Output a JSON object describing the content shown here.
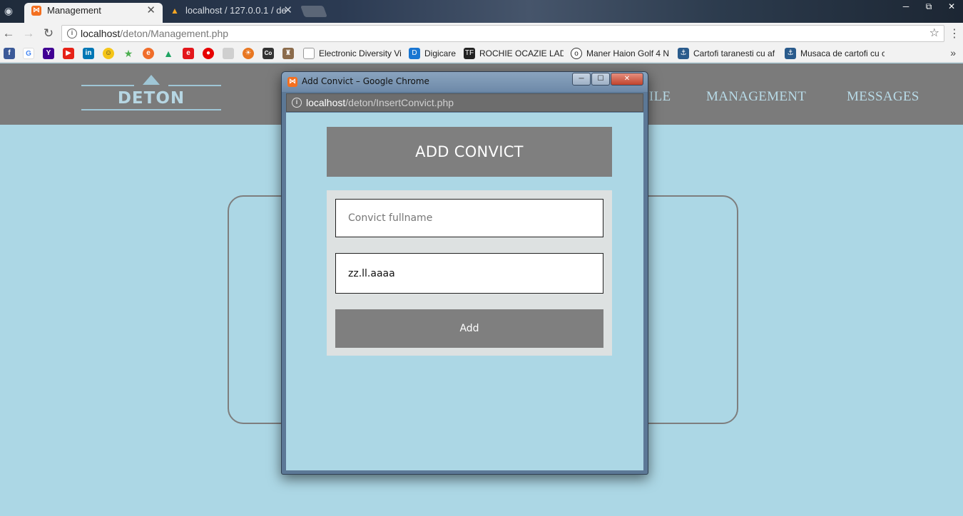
{
  "browser": {
    "tabs": [
      {
        "title": "Management",
        "active": true
      },
      {
        "title": "localhost / 127.0.0.1 / de",
        "active": false
      }
    ],
    "address": {
      "host": "localhost",
      "path": "/deton/Management.php"
    },
    "bookmarks": [
      {
        "label": "Electronic Diversity Vi"
      },
      {
        "label": "Digicare"
      },
      {
        "label": "ROCHIE OCAZIE LADY"
      },
      {
        "label": "Maner Haion Golf 4 N"
      },
      {
        "label": "Cartofi taranesti cu af"
      },
      {
        "label": "Musaca de cartofi cu c"
      }
    ],
    "bookmark_icons": [
      "facebook-icon",
      "google-icon",
      "yahoo-icon",
      "youtube-icon",
      "linkedin-icon",
      "smiley-icon",
      "star-person-icon",
      "orange-circle-icon",
      "google-drive-icon",
      "emag-icon",
      "vodafone-icon",
      "document-icon",
      "sun-icon",
      "co-icon",
      "castle-icon"
    ]
  },
  "site": {
    "logo": "DETON",
    "nav": [
      "ILE",
      "MANAGEMENT",
      "MESSAGES"
    ]
  },
  "popup": {
    "title": "Add Convict – Google Chrome",
    "address": {
      "host": "localhost",
      "path": "/deton/InsertConvict.php"
    },
    "form": {
      "header": "ADD CONVICT",
      "name_placeholder": "Convict fullname",
      "date_placeholder": "zz.ll.aaaa",
      "button": "Add"
    }
  },
  "colors": {
    "page_bg": "#acd7e5",
    "header_bg": "#7b7b7b",
    "nav_text": "#b8dbe8",
    "form_header_bg": "#7f7f7f",
    "form_box_bg": "#dde1e1"
  }
}
